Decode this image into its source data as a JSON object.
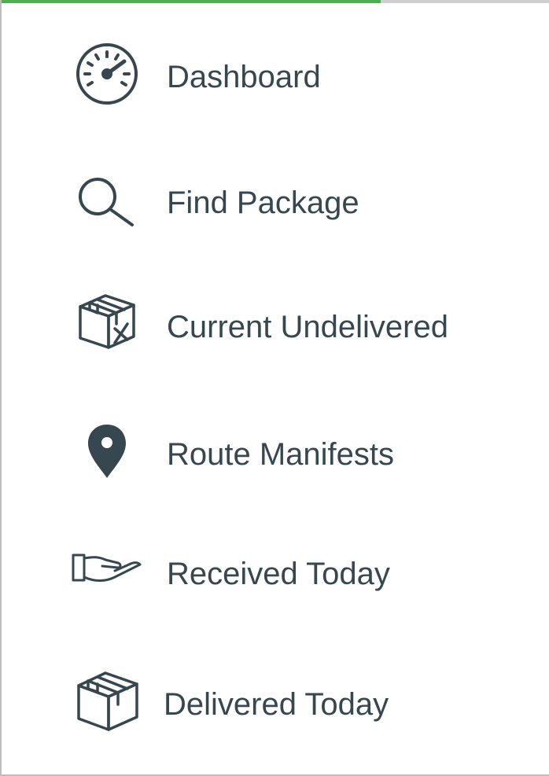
{
  "menu": {
    "items": [
      {
        "id": "dashboard",
        "label": "Dashboard",
        "icon": "speedometer-icon"
      },
      {
        "id": "find-package",
        "label": "Find Package",
        "icon": "search-icon"
      },
      {
        "id": "current-undelivered",
        "label": "Current Undelivered",
        "icon": "box-x-icon"
      },
      {
        "id": "route-manifests",
        "label": "Route Manifests",
        "icon": "map-pin-icon"
      },
      {
        "id": "received-today",
        "label": "Received Today",
        "icon": "hand-receive-icon"
      },
      {
        "id": "delivered-today",
        "label": "Delivered Today",
        "icon": "box-icon"
      }
    ]
  },
  "colors": {
    "text": "#37474f",
    "icon": "#37474f",
    "accent": "#4caf50",
    "border": "#bdbdbd"
  }
}
